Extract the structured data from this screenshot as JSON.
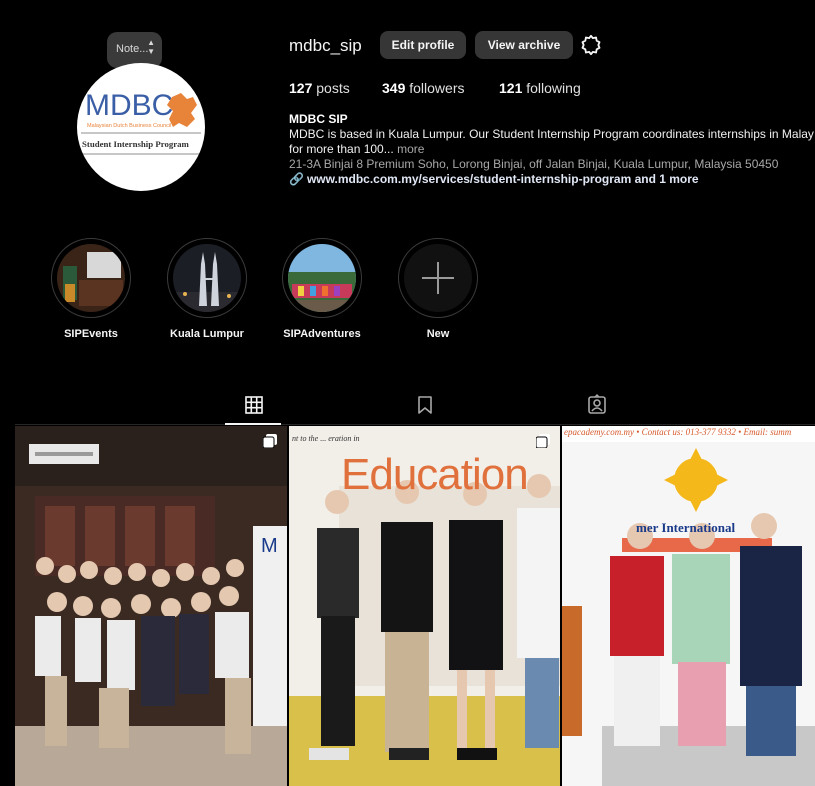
{
  "profile": {
    "username": "mdbc_sip",
    "note_label": "Note...",
    "avatar": {
      "logo_text": "MDBC",
      "council_text": "Malaysian Dutch Business Council",
      "program_text": "Student Internship Program"
    },
    "buttons": {
      "edit": "Edit profile",
      "archive": "View archive"
    }
  },
  "stats": {
    "posts_count": "127",
    "posts_label": "posts",
    "followers_count": "349",
    "followers_label": "followers",
    "following_count": "121",
    "following_label": "following"
  },
  "bio": {
    "name": "MDBC SIP",
    "line1": "MDBC is based in Kuala Lumpur. Our Student Internship Program coordinates internships in Malay",
    "line2": "for more than 100...",
    "more": "more",
    "address": "21-3A Binjai 8 Premium Soho, Lorong Binjai, off Jalan Binjai, Kuala Lumpur, Malaysia 50450",
    "link": "www.mdbc.com.my/services/student-internship-program and 1 more"
  },
  "highlights": [
    {
      "label": "SIPEvents"
    },
    {
      "label": "Kuala Lumpur"
    },
    {
      "label": "SIPAdventures"
    },
    {
      "label": "New"
    }
  ],
  "grid": {
    "post2_sign": "Education",
    "post2_wall": "nt to the ... eration in",
    "post3_banner": "epacademy.com.my • Contact us: 013-377 9332 • Email: summ",
    "post3_school": "mer International"
  },
  "colors": {
    "background": "#000000",
    "button_bg": "#363636",
    "text_primary": "#f5f5f5",
    "text_secondary": "#a8a8a8",
    "mdbc_blue": "#3b5fa6",
    "mdbc_orange": "#e8833a"
  }
}
